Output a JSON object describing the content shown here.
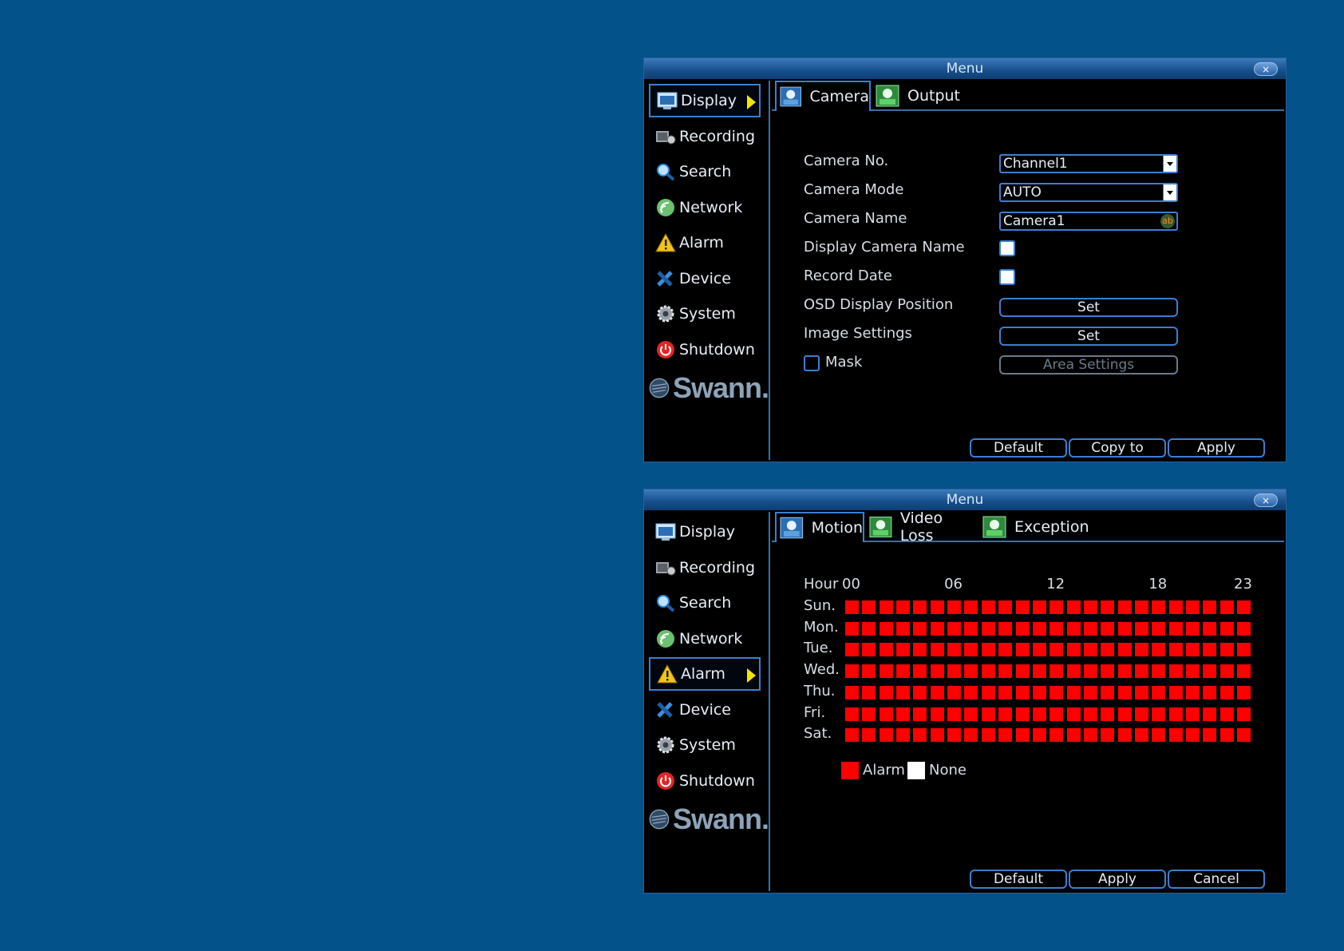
{
  "window1": {
    "title": "Menu",
    "close_label": "×",
    "sidebar": [
      {
        "label": "Display",
        "icon": "display-icon",
        "active": true
      },
      {
        "label": "Recording",
        "icon": "recording-icon",
        "active": false
      },
      {
        "label": "Search",
        "icon": "search-icon",
        "active": false
      },
      {
        "label": "Network",
        "icon": "network-icon",
        "active": false
      },
      {
        "label": "Alarm",
        "icon": "alarm-icon",
        "active": false
      },
      {
        "label": "Device",
        "icon": "device-icon",
        "active": false
      },
      {
        "label": "System",
        "icon": "system-icon",
        "active": false
      },
      {
        "label": "Shutdown",
        "icon": "shutdown-icon",
        "active": false
      }
    ],
    "logo_text": "Swann.",
    "tabs": [
      {
        "label": "Camera",
        "active": true
      },
      {
        "label": "Output",
        "active": false
      }
    ],
    "fields": {
      "camera_no_label": "Camera No.",
      "camera_no_value": "Channel1",
      "camera_mode_label": "Camera Mode",
      "camera_mode_value": "AUTO",
      "camera_name_label": "Camera Name",
      "camera_name_value": "Camera1",
      "display_camera_name_label": "Display Camera Name",
      "display_camera_name_checked": false,
      "record_date_label": "Record Date",
      "record_date_checked": false,
      "osd_label": "OSD Display Position",
      "osd_button": "Set",
      "image_settings_label": "Image Settings",
      "image_settings_button": "Set",
      "mask_label": "Mask",
      "mask_checked": false,
      "area_settings_button": "Area Settings"
    },
    "buttons": {
      "default": "Default",
      "copy_to": "Copy to",
      "apply": "Apply"
    }
  },
  "window2": {
    "title": "Menu",
    "close_label": "×",
    "sidebar": [
      {
        "label": "Display",
        "icon": "display-icon",
        "active": false
      },
      {
        "label": "Recording",
        "icon": "recording-icon",
        "active": false
      },
      {
        "label": "Search",
        "icon": "search-icon",
        "active": false
      },
      {
        "label": "Network",
        "icon": "network-icon",
        "active": false
      },
      {
        "label": "Alarm",
        "icon": "alarm-icon",
        "active": true
      },
      {
        "label": "Device",
        "icon": "device-icon",
        "active": false
      },
      {
        "label": "System",
        "icon": "system-icon",
        "active": false
      },
      {
        "label": "Shutdown",
        "icon": "shutdown-icon",
        "active": false
      }
    ],
    "logo_text": "Swann.",
    "tabs": [
      {
        "label": "Motion",
        "active": true
      },
      {
        "label": "Video Loss",
        "active": false
      },
      {
        "label": "Exception",
        "active": false
      }
    ],
    "schedule": {
      "hour_label": "Hour",
      "hour_ticks": [
        "00",
        "06",
        "12",
        "18",
        "23"
      ],
      "days": [
        "Sun.",
        "Mon.",
        "Tue.",
        "Wed.",
        "Thu.",
        "Fri.",
        "Sat."
      ],
      "hours_per_day": 24,
      "all_alarm": true
    },
    "legend": {
      "alarm_label": "Alarm",
      "none_label": "None",
      "alarm_color": "#ff0000",
      "none_color": "#ffffff"
    },
    "buttons": {
      "default": "Default",
      "apply": "Apply",
      "cancel": "Cancel"
    }
  },
  "colors": {
    "background": "#03528a",
    "accent": "#3b7fd0",
    "alarm": "#ff0000",
    "active_arrow": "#f3e400"
  }
}
